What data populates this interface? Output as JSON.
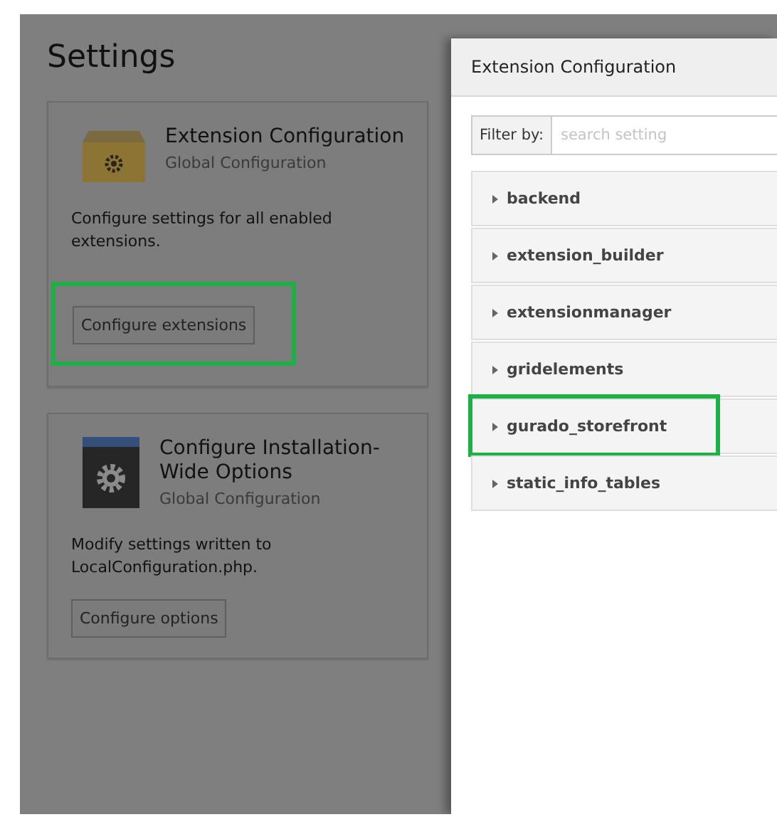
{
  "page": {
    "title": "Settings"
  },
  "cards": [
    {
      "kind": "box",
      "title": "Extension Configuration",
      "subtitle": "Global Configuration",
      "description": "Configure settings for all enabled extensions.",
      "button": {
        "label": "Configure extensions",
        "highlighted": true
      }
    },
    {
      "kind": "panel",
      "title": "Configure Installation-Wide Options",
      "subtitle": "Global Configuration",
      "description": "Modify settings written to LocalConfiguration.php.",
      "button": {
        "label": "Configure options",
        "highlighted": false
      }
    }
  ],
  "modal": {
    "title": "Extension Configuration",
    "filter": {
      "label": "Filter by:",
      "placeholder": "search setting"
    },
    "items": [
      {
        "label": "backend",
        "highlighted": false
      },
      {
        "label": "extension_builder",
        "highlighted": false
      },
      {
        "label": "extensionmanager",
        "highlighted": false
      },
      {
        "label": "gridelements",
        "highlighted": false
      },
      {
        "label": "gurado_storefront",
        "highlighted": true
      },
      {
        "label": "static_info_tables",
        "highlighted": false
      }
    ]
  }
}
